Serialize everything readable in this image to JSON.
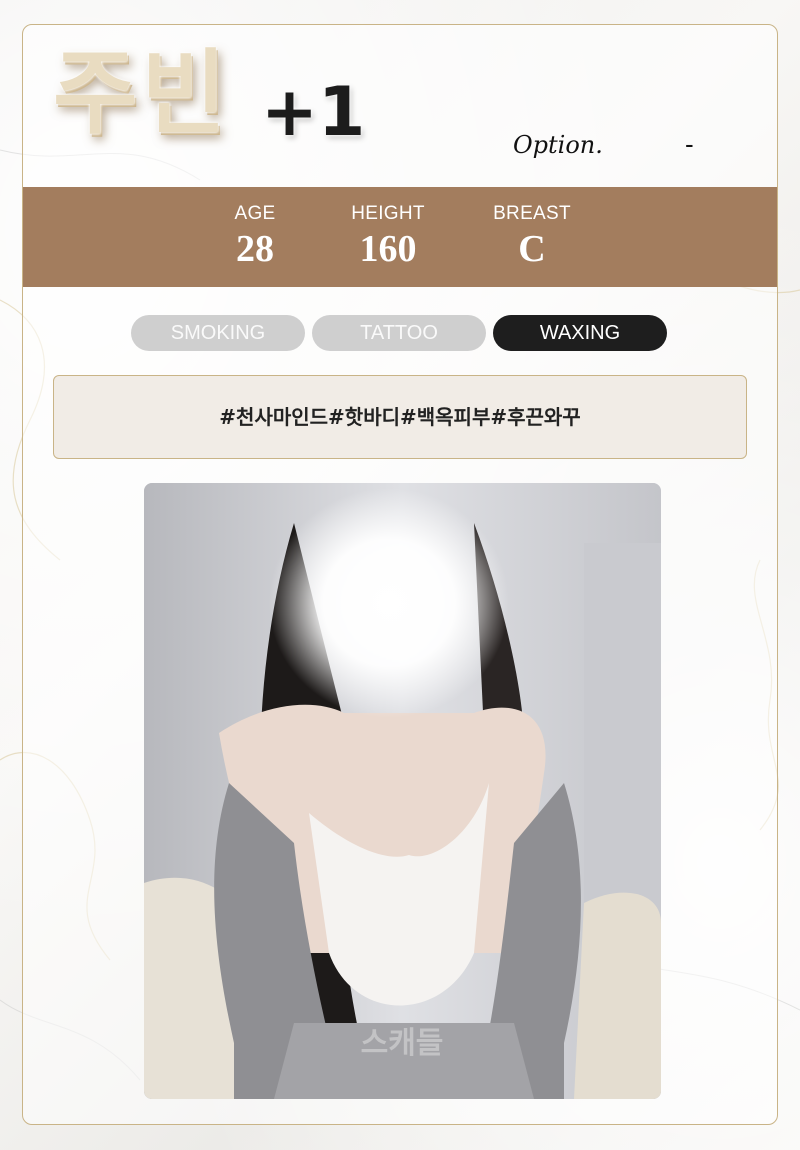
{
  "profile": {
    "name": "주빈",
    "plus": "+1",
    "option_label": "Option.",
    "option_value": "-"
  },
  "stats": [
    {
      "label": "AGE",
      "value": "28"
    },
    {
      "label": "HEIGHT",
      "value": "160"
    },
    {
      "label": "BREAST",
      "value": "C"
    }
  ],
  "badges": [
    {
      "label": "SMOKING",
      "active": false
    },
    {
      "label": "TATTOO",
      "active": false
    },
    {
      "label": "WAXING",
      "active": true
    }
  ],
  "tags": "#천사마인드#핫바디#백옥피부#후끈와꾸",
  "colors": {
    "stats_band": "#a37d5e",
    "border_gold": "#c9b487",
    "badge_inactive": "#cfcfcf",
    "badge_active": "#1e1e1e",
    "tag_box": "#f1ece6"
  },
  "photo": {
    "subject": "profile photo with blurred face",
    "watermark": "스캐들"
  }
}
